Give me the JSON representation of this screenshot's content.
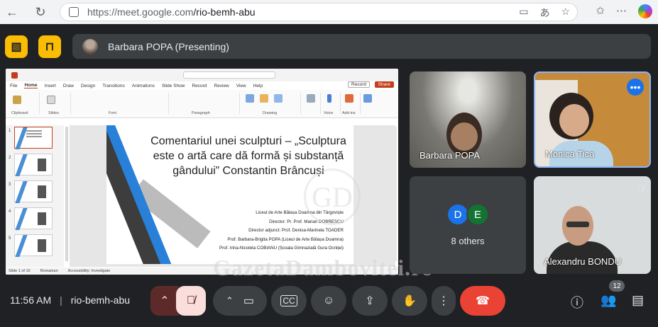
{
  "browser": {
    "url_host": "https://meet.google.com",
    "url_path": "/rio-bemh-abu"
  },
  "presenter_bar": {
    "label": "Barbara POPA (Presenting)"
  },
  "presentation": {
    "menu": [
      "File",
      "Home",
      "Insert",
      "Draw",
      "Design",
      "Transitions",
      "Animations",
      "Slide Show",
      "Record",
      "Review",
      "View",
      "Help"
    ],
    "record_label": "Record",
    "share_label": "Share",
    "slide_title": "Comentariul unei sculpturi – „Sculptura este o artă care dă formă și substanță gândului” Constantin Brâncuși",
    "credits": [
      "Liceul de Arte Bălașa Doamna din Târgoviște",
      "Director: Pr. Prof. Marian DOBRESCU",
      "Director adjunct: Prof. Denisa-Marinela TOADER",
      "Prof. Barbara-Brigita POPA (Liceul de Arte Bălașa Doamna)",
      "Prof. Irina-Nicoleta COBIANU (Școala Gimnazială Gura Ocniței)"
    ],
    "status_slide": "Slide 1 of 10",
    "status_lang": "Romanian",
    "status_accessibility": "Accessibility: Investigate",
    "thumb_numbers": [
      "1",
      "2",
      "3",
      "4",
      "5"
    ]
  },
  "watermark": {
    "text": "GazetaDambovitei.ro",
    "logo": "GD"
  },
  "participants": [
    {
      "name": "Barbara POPA"
    },
    {
      "name": "Monica Tica"
    },
    {
      "name": "Alexandru BONDU"
    }
  ],
  "others": {
    "avatars": [
      "D",
      "E"
    ],
    "label": "8 others"
  },
  "meeting": {
    "time": "11:56 AM",
    "code": "rio-bemh-abu",
    "participant_count": "12"
  },
  "colors": {
    "mute_bg": "#f9dedc",
    "end_call": "#ea4335",
    "accent_blue": "#1a73e8",
    "yellow": "#fbbc04"
  }
}
